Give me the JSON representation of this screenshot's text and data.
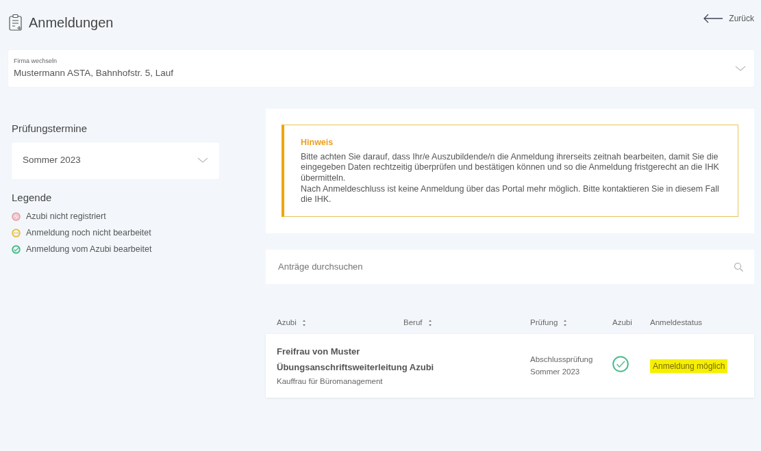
{
  "header": {
    "title": "Anmeldungen",
    "back_link": "Zurück"
  },
  "company_select": {
    "label": "Firma wechseln",
    "value": "Mustermann ASTA, Bahnhofstr. 5, Lauf"
  },
  "exam_dates": {
    "title": "Prüfungstermine",
    "value": "Sommer 2023"
  },
  "legend": {
    "title": "Legende",
    "items": [
      {
        "kind": "not-registered",
        "label": "Azubi nicht registriert",
        "color": "#e8a0a8"
      },
      {
        "kind": "pending",
        "label": "Anmeldung noch nicht bearbeitet",
        "color": "#e8c040"
      },
      {
        "kind": "done",
        "label": "Anmeldung vom Azubi bearbeitet",
        "color": "#4dbb8a"
      }
    ]
  },
  "notice": {
    "title": "Hinweis",
    "paragraphs": [
      "Bitte achten Sie darauf, dass Ihr/e Auszubildende/n die Anmeldung ihrerseits zeitnah bearbeiten, damit Sie die eingegeben Daten rechtzeitig überprüfen und bestätigen können und so die Anmeldung fristgerecht an die IHK übermitteln.",
      "Nach Anmeldeschluss ist keine Anmeldung über das Portal mehr möglich. Bitte kontaktieren Sie in diesem Fall die IHK."
    ]
  },
  "search": {
    "placeholder": "Anträge durchsuchen"
  },
  "table": {
    "columns": [
      {
        "label": "Azubi",
        "sortable": true
      },
      {
        "label": "Beruf",
        "sortable": true
      },
      {
        "label": "Prüfung",
        "sortable": true
      },
      {
        "label": "Azubi",
        "sortable": false
      },
      {
        "label": "Anmeldestatus",
        "sortable": false
      }
    ],
    "rows": [
      {
        "name": "Freifrau von Muster",
        "name_line_2": "Übungsanschriftsweiterleitung Azubi",
        "occupation": "Kauffrau für Büromanagement",
        "exam": "Abschlussprüfung",
        "exam_term": "Sommer 2023",
        "azubi_processed": true,
        "status": "Anmeldung möglich",
        "highlighted": true
      }
    ]
  }
}
